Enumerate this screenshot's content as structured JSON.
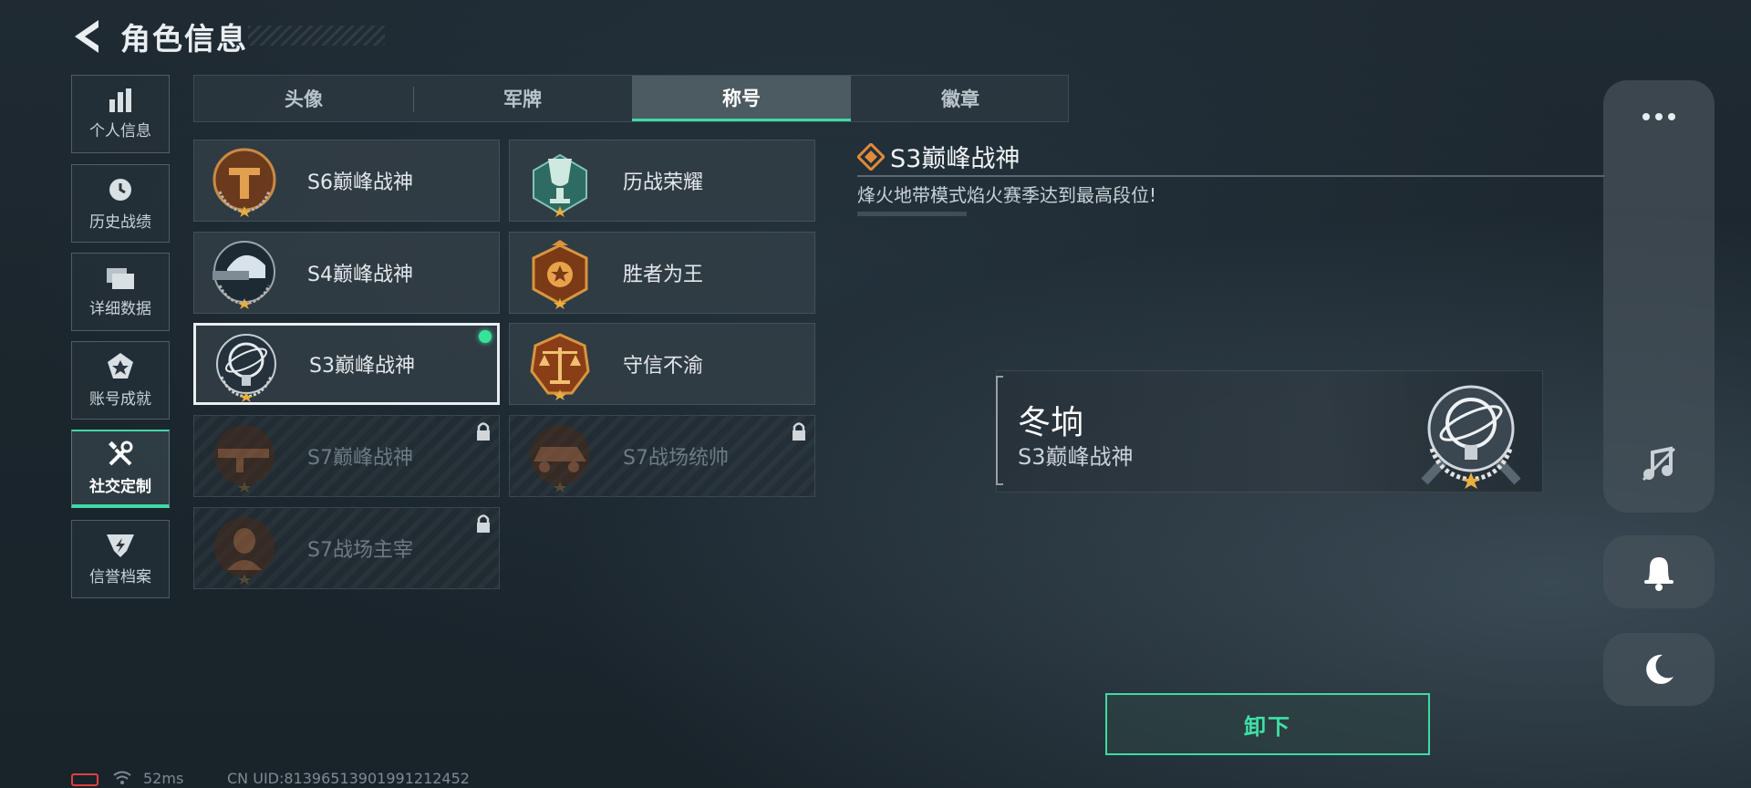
{
  "header": {
    "title": "角色信息"
  },
  "sidebar": {
    "items": [
      {
        "label": "个人信息",
        "icon": "bar-chart-icon"
      },
      {
        "label": "历史战绩",
        "icon": "clock-icon"
      },
      {
        "label": "详细数据",
        "icon": "folder-icon"
      },
      {
        "label": "账号成就",
        "icon": "achievement-icon"
      },
      {
        "label": "社交定制",
        "icon": "tools-icon",
        "active": true
      },
      {
        "label": "信誉档案",
        "icon": "credit-shield-icon"
      }
    ]
  },
  "tabs": [
    {
      "label": "头像"
    },
    {
      "label": "军牌"
    },
    {
      "label": "称号",
      "active": true
    },
    {
      "label": "徽章"
    }
  ],
  "titles": [
    {
      "label": "S6巅峰战神",
      "locked": false
    },
    {
      "label": "历战荣耀",
      "locked": false
    },
    {
      "label": "S4巅峰战神",
      "locked": false
    },
    {
      "label": "胜者为王",
      "locked": false
    },
    {
      "label": "S3巅峰战神",
      "locked": false,
      "selected": true,
      "equipped": true
    },
    {
      "label": "守信不渝",
      "locked": false
    },
    {
      "label": "S7巅峰战神",
      "locked": true
    },
    {
      "label": "S7战场统帅",
      "locked": true
    },
    {
      "label": "S7战场主宰",
      "locked": true
    }
  ],
  "detail": {
    "title": "S3巅峰战神",
    "description": "烽火地带模式焰火赛季达到最高段位!"
  },
  "preview": {
    "player_name": "冬垧",
    "title": "S3巅峰战神"
  },
  "actions": {
    "unequip_label": "卸下"
  },
  "status_bar": {
    "ping": "52ms",
    "uid": "CN UID:81396513901991212452"
  },
  "colors": {
    "accent": "#3fd9a5",
    "equipped": "#37e39a",
    "battery": "#e04040"
  }
}
